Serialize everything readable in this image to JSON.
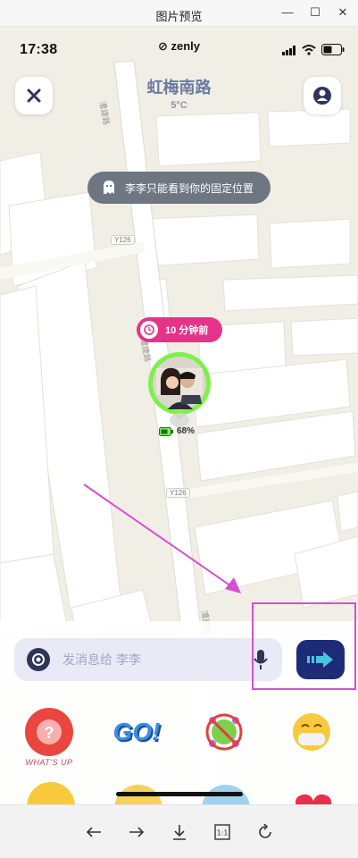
{
  "window": {
    "title": "图片预览"
  },
  "status": {
    "time": "17:38",
    "brand": "zenly"
  },
  "header": {
    "street": "虹梅南路",
    "temperature": "5°C"
  },
  "privacy_notice": "李李只能看到你的固定位置",
  "map": {
    "road_labels": [
      "Y126",
      "Y126"
    ],
    "road_names": [
      "漕建路",
      "漕建路",
      "漕建路"
    ]
  },
  "friend": {
    "last_seen": "10 分钟前",
    "battery": "68%"
  },
  "composer": {
    "placeholder": "发消息给 李李"
  },
  "stickers": {
    "whats_up_label": "WHAT'S UP",
    "go_text": "GO!"
  },
  "colors": {
    "accent_pink": "#e5338a",
    "send_blue": "#1e2b78",
    "online_green": "#7ef04a",
    "highlight": "#d64fd0"
  },
  "icons": [
    "close-icon",
    "profile-icon",
    "ghost-icon",
    "clock-icon",
    "battery-icon",
    "camera-icon",
    "mic-icon",
    "send-arrow-icon",
    "back-icon",
    "forward-icon",
    "download-icon",
    "actual-size-icon",
    "rotate-icon"
  ]
}
